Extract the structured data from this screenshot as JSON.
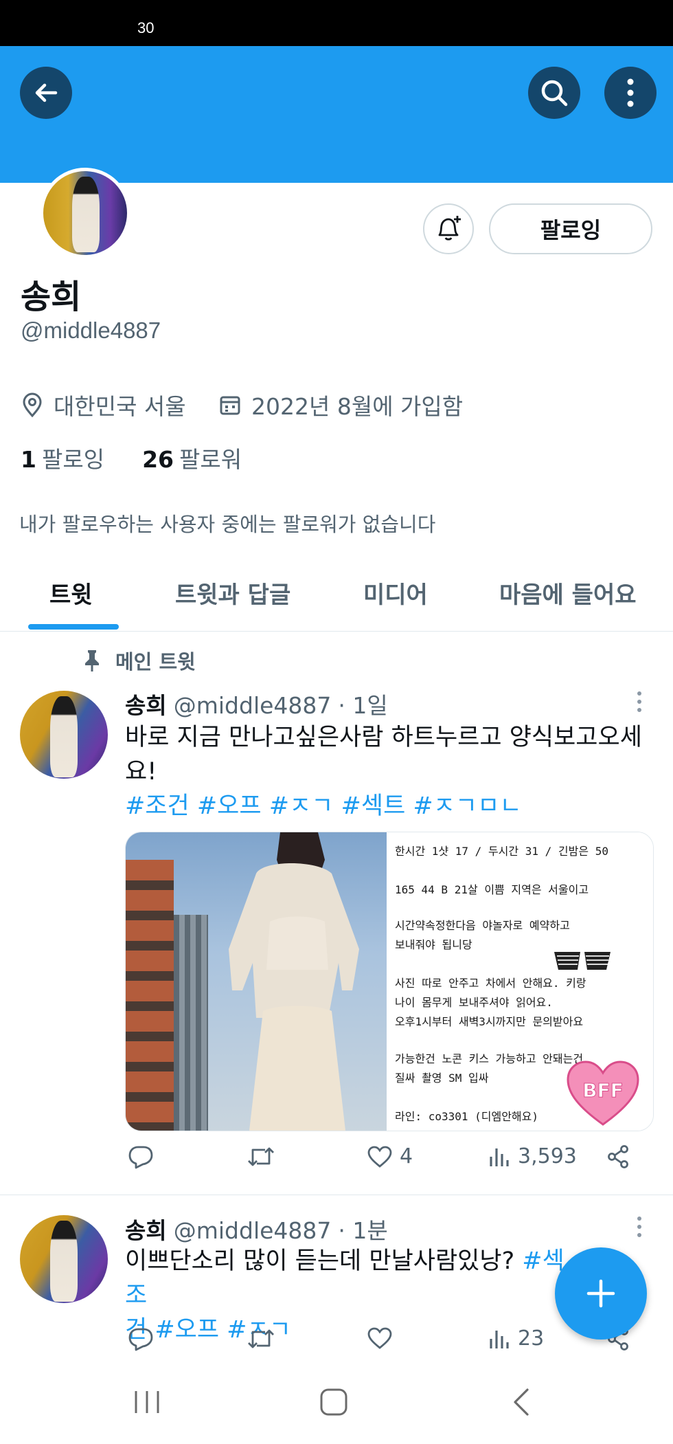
{
  "status_bar": {
    "time": "30"
  },
  "profile": {
    "name": "송희",
    "handle": "@middle4887",
    "location": "대한민국 서울",
    "joined": "2022년 8월에 가입함",
    "following_count": "1",
    "following_label": "팔로잉",
    "followers_count": "26",
    "followers_label": "팔로워",
    "follow_button": "팔로잉",
    "mutual_note": "내가 팔로우하는 사용자 중에는 팔로워가 없습니다"
  },
  "tabs": [
    "트윗",
    "트윗과 답글",
    "미디어",
    "마음에 들어요"
  ],
  "pinned_label": "메인 트윗",
  "tweets": [
    {
      "name": "송희",
      "handle": "@middle4887",
      "time": "· 1일",
      "text": "바로 지금 만나고싶은사람 하트누르고 양식보고오세요!",
      "tags": "#조건 #오프 #ㅈㄱ #섹트 #ㅈㄱㅁㄴ",
      "likes": "4",
      "views": "3,593",
      "media_notes": [
        "한시간 1샷 17 / 두시간 31 / 긴밤은 50",
        "165 44 B 21살 이쁨 지역은 서울이고",
        "시간약속정한다음 야놀자로 예약하고",
        "보내줘야 됩니당",
        "사진 따로 안주고 차에서 안해요. 키랑",
        "나이 몸무게 보내주셔야 읽어요.",
        "오후1시부터 새벽3시까지만 문의받아요",
        "가능한건 노콘 키스 가능하고 안돼는건",
        "질싸 촬영 SM 입싸",
        "라인: co3301 (디엠안해요)"
      ],
      "sticker": "BFF"
    },
    {
      "name": "송희",
      "handle": "@middle4887",
      "time": "· 1분",
      "text": "이쁘단소리 많이 듣는데 만날사람있낭?",
      "tags_inline": "#섹",
      "tags_inline2": "조",
      "tags_line2": "건 #오프 #ㅈㄱ",
      "likes": "",
      "views": "23"
    }
  ],
  "colors": {
    "accent": "#1d9bf0",
    "banner": "#1d9bf0",
    "text_secondary": "#536471"
  },
  "icons": [
    "back-arrow-icon",
    "search-icon",
    "more-vertical-icon",
    "bell-plus-icon",
    "location-pin-icon",
    "calendar-icon",
    "pin-icon",
    "reply-icon",
    "retweet-icon",
    "heart-icon",
    "views-icon",
    "share-icon",
    "plus-icon"
  ]
}
